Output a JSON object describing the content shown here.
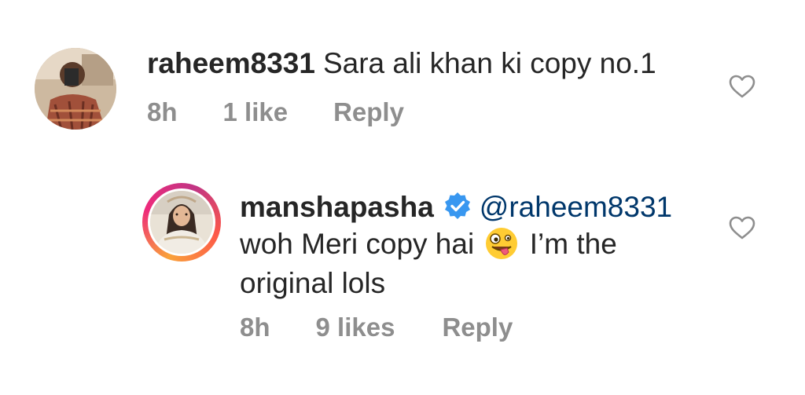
{
  "comments": [
    {
      "username": "raheem8331",
      "text": "Sara ali khan ki copy no.1",
      "time": "8h",
      "likes": "1 like",
      "reply_label": "Reply",
      "avatar_icon": "user-photo-avatar"
    }
  ],
  "reply": {
    "username": "manshapasha",
    "verified_icon": "verified-badge-icon",
    "mention": "@raheem8331",
    "text_before_emoji": "woh Meri copy hai",
    "emoji": "zany-face-emoji",
    "text_after_emoji": "I’m the original lols",
    "time": "8h",
    "likes": "9 likes",
    "reply_label": "Reply",
    "avatar_icon": "user-photo-avatar",
    "story_ring_colors": [
      "#f9a23a",
      "#ee2a7b",
      "#c13584"
    ]
  },
  "icons": {
    "like": "heart-outline-icon"
  },
  "colors": {
    "text": "#262626",
    "meta": "#8e8e8e",
    "mention": "#00376b",
    "verified": "#3897f0"
  }
}
